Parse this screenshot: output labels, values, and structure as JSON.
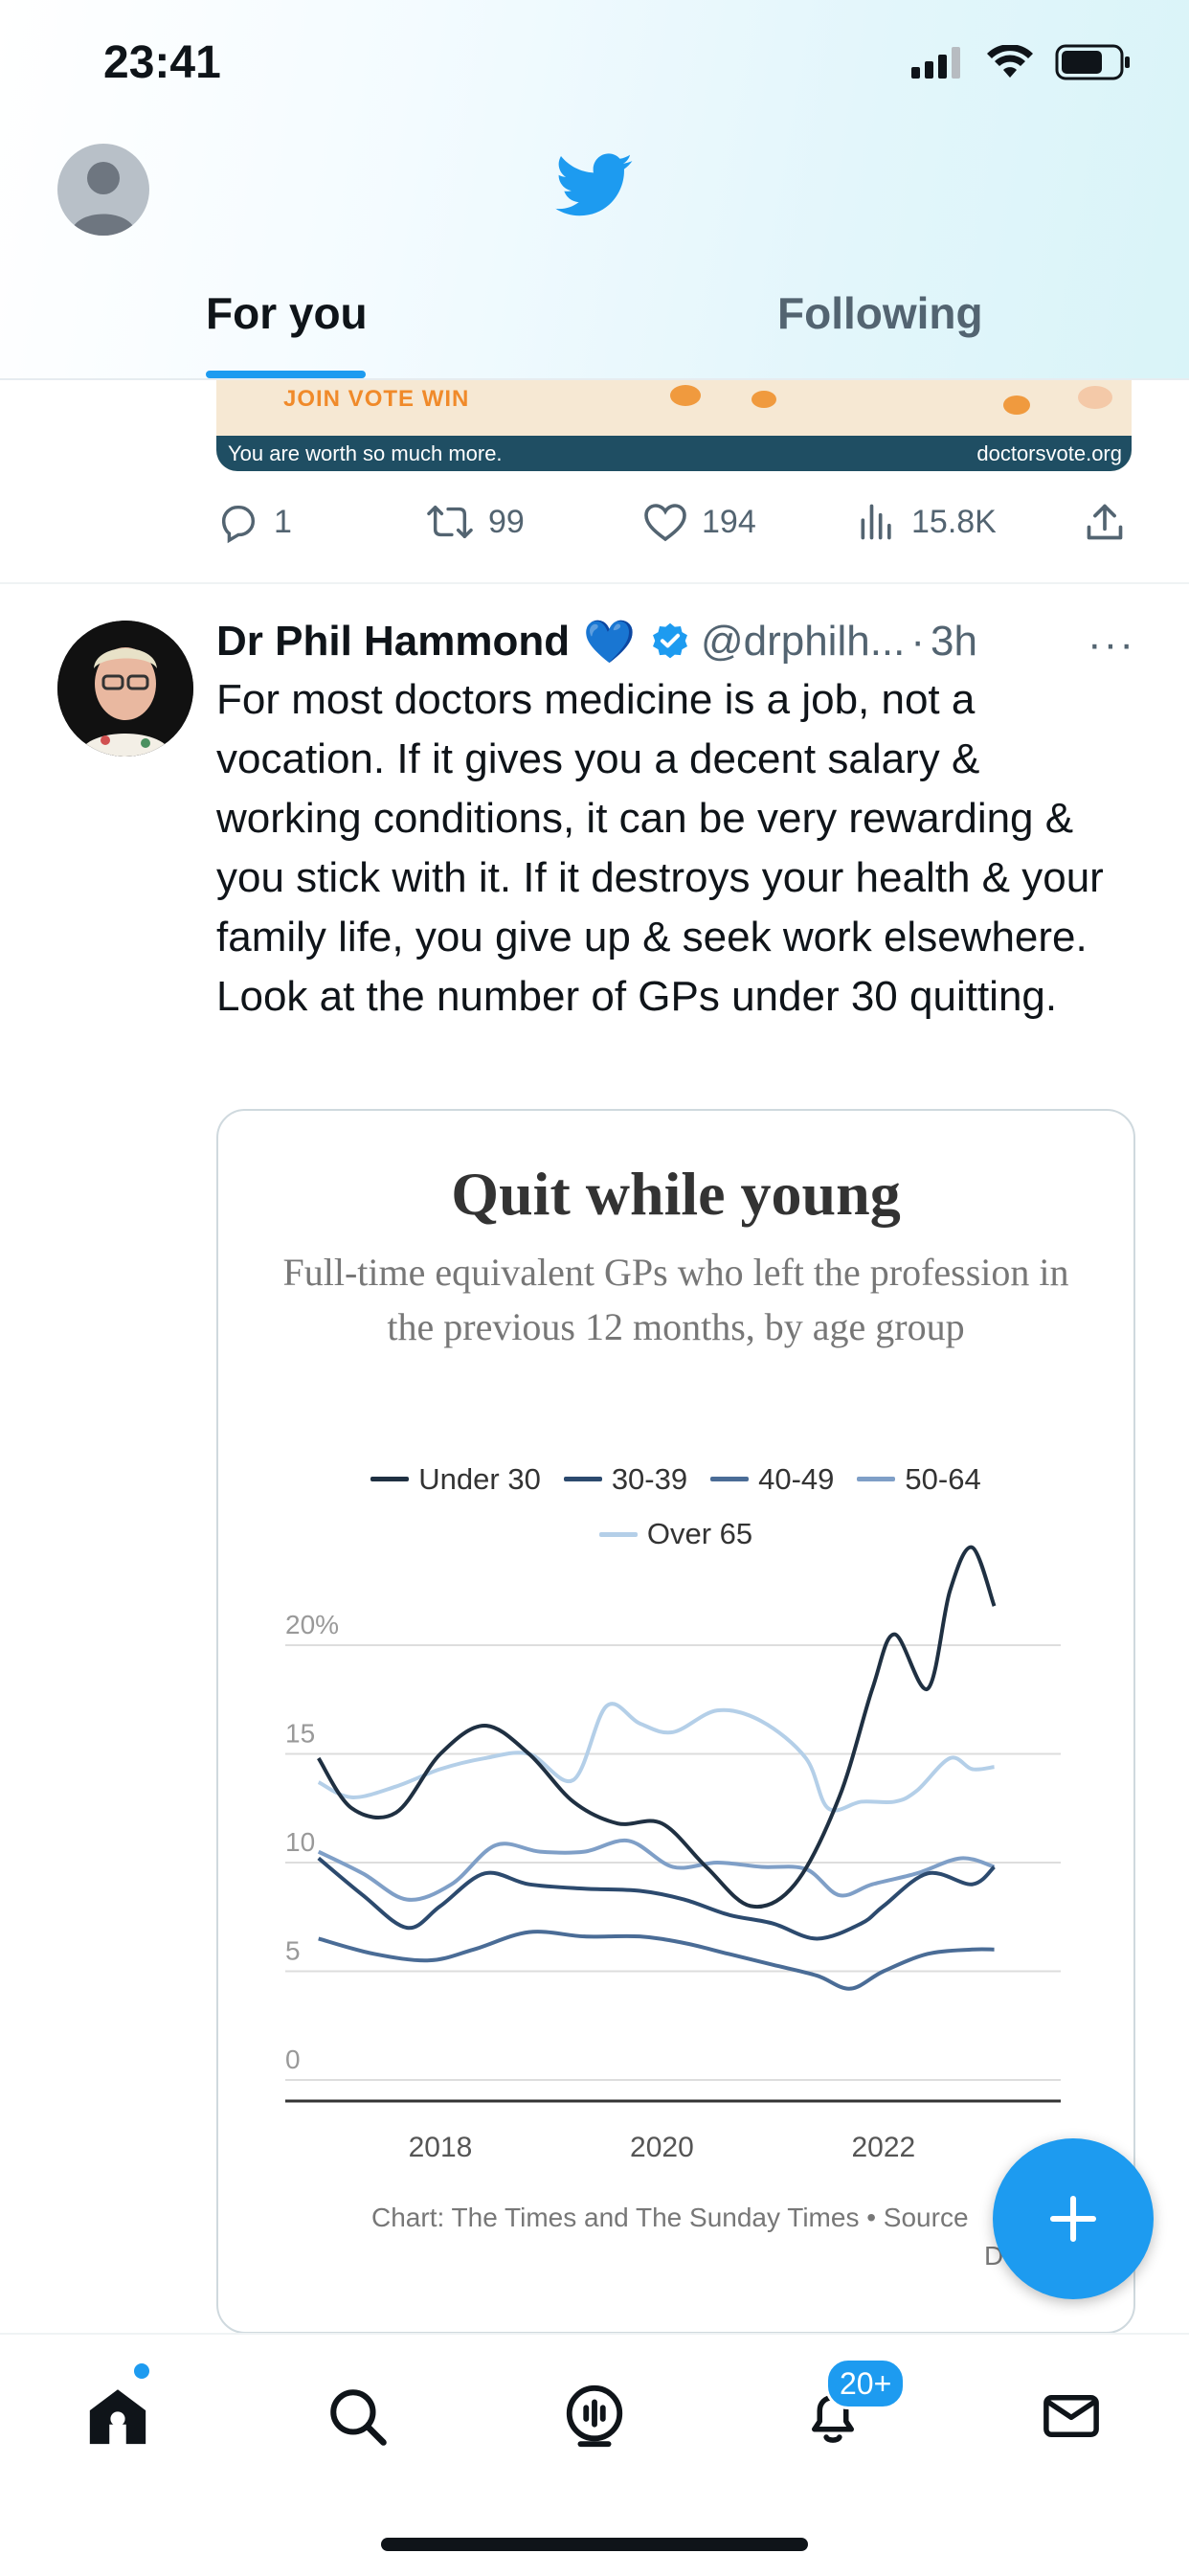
{
  "status_bar": {
    "time": "23:41"
  },
  "header": {
    "tabs": [
      {
        "label": "For you",
        "active": true
      },
      {
        "label": "Following",
        "active": false
      }
    ],
    "accent": "#1d9bf0"
  },
  "previous_tweet": {
    "banner": {
      "top_text": "JOIN VOTE WIN",
      "left_text": "You are worth so much more.",
      "right_text": "doctorsvote.org"
    },
    "stats": {
      "replies": "1",
      "retweets": "99",
      "likes": "194",
      "views": "15.8K"
    }
  },
  "tweet": {
    "author_name": "Dr Phil Hammond",
    "emoji": "💙",
    "handle": "@drphilh...",
    "separator": "·",
    "time": "3h",
    "more": "···",
    "text": "For most doctors medicine is a job, not a vocation. If it gives you a decent salary & working conditions, it can be very rewarding & you stick with it. If it destroys your health & your family life, you give up & seek work elsewhere. Look at the number of GPs under 30 quitting."
  },
  "chart_data": {
    "type": "line",
    "title": "Quit while young",
    "subtitle": "Full-time equivalent GPs who left the profession in the previous 12 months, by age group",
    "xlabel": "",
    "ylabel": "",
    "ylim": [
      0,
      20
    ],
    "y_ticks": [
      "0",
      "5",
      "10",
      "15",
      "20%"
    ],
    "x_ticks": [
      "2018",
      "2020",
      "2022"
    ],
    "xlim": [
      2016.6,
      2023.6
    ],
    "legend_position": "top",
    "grid": true,
    "series": [
      {
        "name": "Under 30",
        "color": "#1f3042",
        "x": [
          2016.9,
          2017.2,
          2017.6,
          2018.0,
          2018.4,
          2018.8,
          2019.2,
          2019.6,
          2020.0,
          2020.4,
          2020.8,
          2021.2,
          2021.6,
          2021.9,
          2022.1,
          2022.4,
          2022.6,
          2022.8,
          2023.0
        ],
        "values": [
          14.8,
          12.5,
          12.3,
          15.0,
          16.3,
          15.0,
          12.8,
          11.8,
          11.8,
          9.8,
          8.0,
          9.0,
          13.0,
          18.0,
          20.5,
          18.0,
          22.5,
          24.5,
          21.8
        ]
      },
      {
        "name": "30-39",
        "color": "#2c4a6e",
        "x": [
          2016.9,
          2017.3,
          2017.7,
          2018.0,
          2018.4,
          2018.8,
          2019.3,
          2019.8,
          2020.2,
          2020.6,
          2021.0,
          2021.4,
          2021.8,
          2022.0,
          2022.4,
          2022.8,
          2023.0
        ],
        "values": [
          10.2,
          8.5,
          7.0,
          8.0,
          9.5,
          9.0,
          8.8,
          8.7,
          8.3,
          7.6,
          7.2,
          6.5,
          7.2,
          8.0,
          9.5,
          9.0,
          9.8
        ]
      },
      {
        "name": "40-49",
        "color": "#4a6c96",
        "x": [
          2016.9,
          2017.4,
          2017.9,
          2018.3,
          2018.8,
          2019.3,
          2019.8,
          2020.2,
          2020.6,
          2021.0,
          2021.4,
          2021.7,
          2022.0,
          2022.4,
          2022.8,
          2023.0
        ],
        "values": [
          6.5,
          5.8,
          5.5,
          6.0,
          6.8,
          6.6,
          6.6,
          6.3,
          5.8,
          5.3,
          4.8,
          4.2,
          5.0,
          5.8,
          6.0,
          6.0
        ]
      },
      {
        "name": "50-64",
        "color": "#7f9fc7",
        "x": [
          2016.9,
          2017.3,
          2017.7,
          2018.1,
          2018.5,
          2018.9,
          2019.3,
          2019.7,
          2020.1,
          2020.5,
          2020.9,
          2021.3,
          2021.6,
          2021.9,
          2022.3,
          2022.7,
          2023.0
        ],
        "values": [
          10.5,
          9.5,
          8.3,
          9.0,
          10.8,
          10.5,
          10.5,
          11.0,
          9.8,
          10.0,
          9.8,
          9.7,
          8.5,
          9.0,
          9.5,
          10.2,
          9.8
        ]
      },
      {
        "name": "Over 65",
        "color": "#b4cfe8",
        "x": [
          2016.9,
          2017.2,
          2017.6,
          2018.0,
          2018.4,
          2018.8,
          2019.2,
          2019.5,
          2019.8,
          2020.1,
          2020.5,
          2020.9,
          2021.3,
          2021.5,
          2021.8,
          2022.1,
          2022.3,
          2022.6,
          2022.8,
          2023.0
        ],
        "values": [
          13.7,
          13.0,
          13.5,
          14.3,
          14.8,
          15.0,
          13.8,
          17.2,
          16.4,
          16.0,
          17.0,
          16.5,
          14.8,
          12.5,
          12.8,
          12.8,
          13.3,
          14.8,
          14.3,
          14.4
        ]
      }
    ],
    "caption": "Chart: The Times and The Sunday Times • Source",
    "caption_cont": "D"
  },
  "bottom_nav": {
    "notification_badge": "20+"
  }
}
